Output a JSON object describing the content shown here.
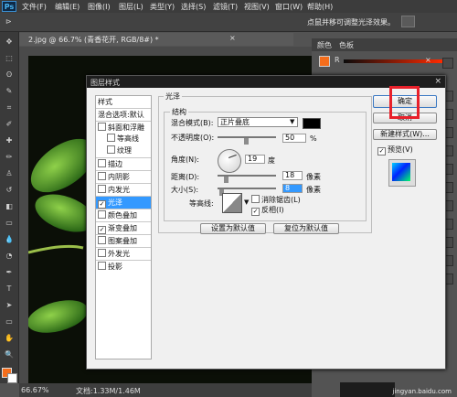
{
  "menu": {
    "logo": "Ps",
    "items": [
      "文件(F)",
      "编辑(E)",
      "图像(I)",
      "图层(L)",
      "类型(Y)",
      "选择(S)",
      "滤镜(T)",
      "视图(V)",
      "窗口(W)",
      "帮助(H)"
    ]
  },
  "options_bar": {
    "hint": "点鼠并移可调整光泽效果。"
  },
  "document": {
    "tab_label": "2.jpg @ 66.7% (青香花开, RGB/8#) *",
    "tab_close": "×"
  },
  "status": {
    "zoom": "66.67%",
    "doc": "文档:1.33M/1.46M"
  },
  "panels": {
    "tabs": [
      "颜色",
      "色板"
    ],
    "r_label": "R",
    "close": "×"
  },
  "dialog": {
    "title": "图层样式",
    "sidebar": {
      "header": "样式",
      "blend_options": "混合选项:默认",
      "items": [
        {
          "label": "斜面和浮雕",
          "checked": false,
          "indent": false
        },
        {
          "label": "等高线",
          "checked": false,
          "indent": true
        },
        {
          "label": "纹理",
          "checked": false,
          "indent": true
        },
        {
          "label": "描边",
          "checked": false,
          "indent": false
        },
        {
          "label": "内阴影",
          "checked": false,
          "indent": false
        },
        {
          "label": "内发光",
          "checked": false,
          "indent": false
        },
        {
          "label": "光泽",
          "checked": true,
          "indent": false,
          "selected": true
        },
        {
          "label": "颜色叠加",
          "checked": false,
          "indent": false
        },
        {
          "label": "渐变叠加",
          "checked": true,
          "indent": false
        },
        {
          "label": "图案叠加",
          "checked": false,
          "indent": false
        },
        {
          "label": "外发光",
          "checked": false,
          "indent": false
        },
        {
          "label": "投影",
          "checked": false,
          "indent": false
        }
      ]
    },
    "satin": {
      "group_title": "光泽",
      "structure_title": "结构",
      "blend_mode_label": "混合模式(B):",
      "blend_mode_value": "正片叠底",
      "blend_color": "#000000",
      "opacity_label": "不透明度(O):",
      "opacity_value": "50",
      "opacity_unit": "%",
      "angle_label": "角度(N):",
      "angle_value": "19",
      "angle_unit": "度",
      "distance_label": "距离(D):",
      "distance_value": "18",
      "distance_unit": "像素",
      "size_label": "大小(S):",
      "size_value": "8",
      "size_unit": "像素",
      "contour_label": "等高线:",
      "antialias_label": "消除锯齿(L)",
      "antialias_checked": false,
      "invert_label": "反相(I)",
      "invert_checked": true,
      "make_default": "设置为默认值",
      "reset_default": "复位为默认值"
    },
    "buttons": {
      "ok": "确定",
      "cancel": "取消",
      "new_style": "新建样式(W)...",
      "preview_label": "预览(V)",
      "preview_checked": true
    }
  },
  "watermark": "jingyan.baidu.com"
}
